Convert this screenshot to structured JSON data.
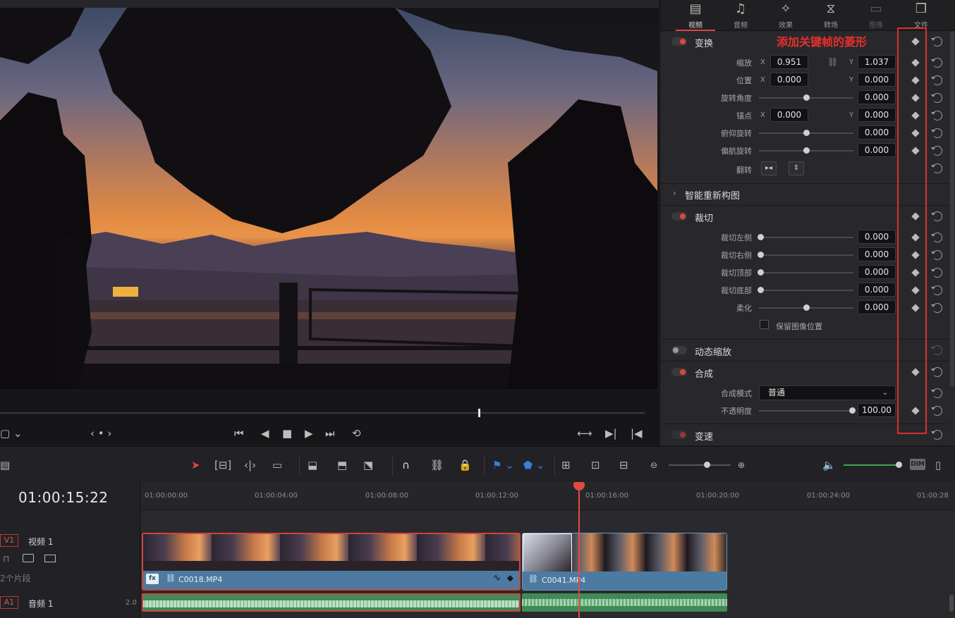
{
  "inspector": {
    "tabs": [
      {
        "label": "视频",
        "icon": "film-icon"
      },
      {
        "label": "音频",
        "icon": "music-note-icon"
      },
      {
        "label": "效果",
        "icon": "magic-wand-icon"
      },
      {
        "label": "转场",
        "icon": "transition-icon"
      },
      {
        "label": "图像",
        "icon": "image-icon"
      },
      {
        "label": "文件",
        "icon": "file-box-icon"
      }
    ],
    "annotation": "添加关键帧的菱形",
    "transform": {
      "title": "变换",
      "zoom": {
        "label": "缩放",
        "x_axis": "X",
        "x": "0.951",
        "y_axis": "Y",
        "y": "1.037"
      },
      "position": {
        "label": "位置",
        "x_axis": "X",
        "x": "0.000",
        "y_axis": "Y",
        "y": "0.000"
      },
      "rotation": {
        "label": "旋转角度",
        "value": "0.000"
      },
      "anchor": {
        "label": "锚点",
        "x_axis": "X",
        "x": "0.000",
        "y_axis": "Y",
        "y": "0.000"
      },
      "pitch": {
        "label": "俯仰旋转",
        "value": "0.000"
      },
      "yaw": {
        "label": "偏航旋转",
        "value": "0.000"
      },
      "flip": {
        "label": "翻转"
      }
    },
    "smart_reframe": {
      "title": "智能重新构图"
    },
    "crop": {
      "title": "裁切",
      "left": {
        "label": "裁切左侧",
        "value": "0.000"
      },
      "right": {
        "label": "裁切右侧",
        "value": "0.000"
      },
      "top": {
        "label": "裁切顶部",
        "value": "0.000"
      },
      "bottom": {
        "label": "裁切底部",
        "value": "0.000"
      },
      "softness": {
        "label": "柔化",
        "value": "0.000"
      },
      "retain_label": "保留图像位置"
    },
    "dynamic_zoom": {
      "title": "动态缩放"
    },
    "composite": {
      "title": "合成",
      "mode_label": "合成模式",
      "mode_value": "普通",
      "opacity_label": "不透明度",
      "opacity_value": "100.00"
    },
    "speed": {
      "title": "变速"
    }
  },
  "timeline": {
    "timecode": "01:00:15:22",
    "ruler": [
      "01:00:00:00",
      "01:00:04:00",
      "01:00:08:00",
      "01:00:12:00",
      "01:00:16:00",
      "01:00:20:00",
      "01:00:24:00",
      "01:00:28"
    ],
    "video_track": {
      "badge": "V1",
      "name": "视频 1",
      "clips_count": "2个片段"
    },
    "audio_track": {
      "badge": "A1",
      "name": "音频 1",
      "level": "2.0"
    },
    "clips": [
      {
        "name": "C0018.MP4",
        "fx": "fx"
      },
      {
        "name": "C0041.MP4"
      }
    ]
  },
  "toolbar": {
    "dim_label": "DIM"
  },
  "colors": {
    "accent": "#e0443e",
    "clip_blue": "#4d7aa0",
    "audio_green": "#3f8a55",
    "annotation_red": "#d8302a"
  }
}
